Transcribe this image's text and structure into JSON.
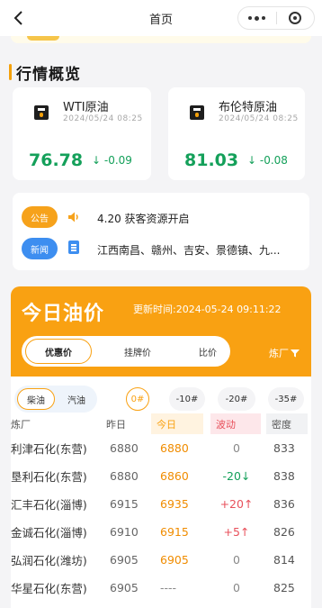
{
  "navbar": {
    "title": "首页",
    "back_icon": "chevron-left-icon",
    "more_icon": "more-dots-icon",
    "close_icon": "target-circle-icon"
  },
  "market": {
    "section_title": "行情概览",
    "cards": [
      {
        "name": "WTI原油",
        "date": "2024/05/24 08:25",
        "price": "76.78",
        "change": "-0.09",
        "direction": "down"
      },
      {
        "name": "布伦特原油",
        "date": "2024/05/24 08:25",
        "price": "81.03",
        "change": "-0.08",
        "direction": "down"
      }
    ]
  },
  "notices": {
    "announcement_tag": "公告",
    "announcement_text": "4.20 获客资源开启",
    "news_tag": "新闻",
    "news_text": "江西南昌、赣州、吉安、景德镇、九..."
  },
  "oil_price": {
    "title": "今日油价",
    "update_time": "更新时间:2024-05-24 09:11:22",
    "tabs": [
      "优惠价",
      "挂牌价",
      "比价"
    ],
    "active_tab": 0,
    "factory_filter": "炼厂",
    "fuel_types": [
      "柴油",
      "汽油"
    ],
    "active_fuel": 0,
    "grades": [
      "0#",
      "-10#",
      "-20#",
      "-35#"
    ],
    "active_grade": 0,
    "columns": [
      "炼厂",
      "昨日",
      "今日",
      "波动",
      "密度"
    ],
    "rows": [
      {
        "factory": "利津石化(东营)",
        "yesterday": "6880",
        "today": "6880",
        "change": "0",
        "density": "833"
      },
      {
        "factory": "垦利石化(东营)",
        "yesterday": "6880",
        "today": "6860",
        "change": "-20",
        "density": "838"
      },
      {
        "factory": "汇丰石化(淄博)",
        "yesterday": "6915",
        "today": "6935",
        "change": "+20",
        "density": "836"
      },
      {
        "factory": "金诚石化(淄博)",
        "yesterday": "6910",
        "today": "6915",
        "change": "+5",
        "density": "826"
      },
      {
        "factory": "弘润石化(潍坊)",
        "yesterday": "6905",
        "today": "6905",
        "change": "0",
        "density": "814"
      },
      {
        "factory": "华星石化(东营)",
        "yesterday": "6905",
        "today": "----",
        "change": "0",
        "density": "825"
      }
    ]
  },
  "colors": {
    "accent": "#f9a112",
    "up": "#e8505b",
    "down": "#14a05a",
    "news_blue": "#3d8ef0"
  }
}
